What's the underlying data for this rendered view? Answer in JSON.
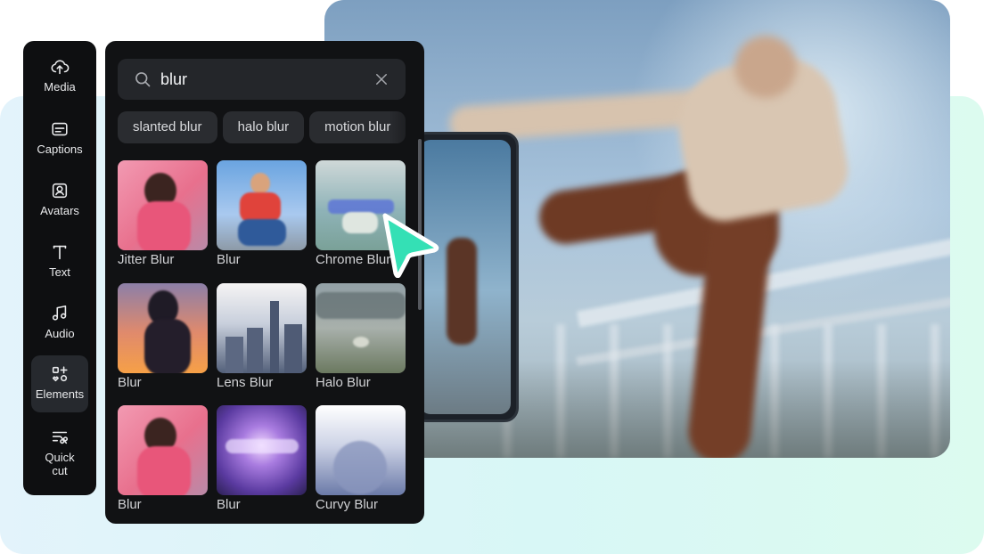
{
  "colors": {
    "accent_cursor": "#34e0b5",
    "rail_bg": "#0e0f11",
    "panel_bg": "#111214",
    "search_bg": "#24262a"
  },
  "sidebar": {
    "items": [
      {
        "label": "Media",
        "icon": "cloud-upload-icon",
        "active": false
      },
      {
        "label": "Captions",
        "icon": "captions-icon",
        "active": false
      },
      {
        "label": "Avatars",
        "icon": "avatar-icon",
        "active": false
      },
      {
        "label": "Text",
        "icon": "text-icon",
        "active": false
      },
      {
        "label": "Audio",
        "icon": "music-note-icon",
        "active": false
      },
      {
        "label": "Elements",
        "icon": "elements-icon",
        "active": true
      },
      {
        "label": "Quick\ncut",
        "icon": "quick-cut-icon",
        "active": false
      }
    ]
  },
  "search": {
    "value": "blur",
    "icon": "search-icon",
    "clear_icon": "close-icon"
  },
  "chips": [
    "slanted blur",
    "halo blur",
    "motion blur"
  ],
  "effects": [
    {
      "label": "Jitter Blur"
    },
    {
      "label": "Blur"
    },
    {
      "label": "Chrome Blur"
    },
    {
      "label": "Blur"
    },
    {
      "label": "Lens Blur"
    },
    {
      "label": "Halo Blur"
    },
    {
      "label": "Blur"
    },
    {
      "label": "Blur"
    },
    {
      "label": "Curvy Blur"
    }
  ]
}
